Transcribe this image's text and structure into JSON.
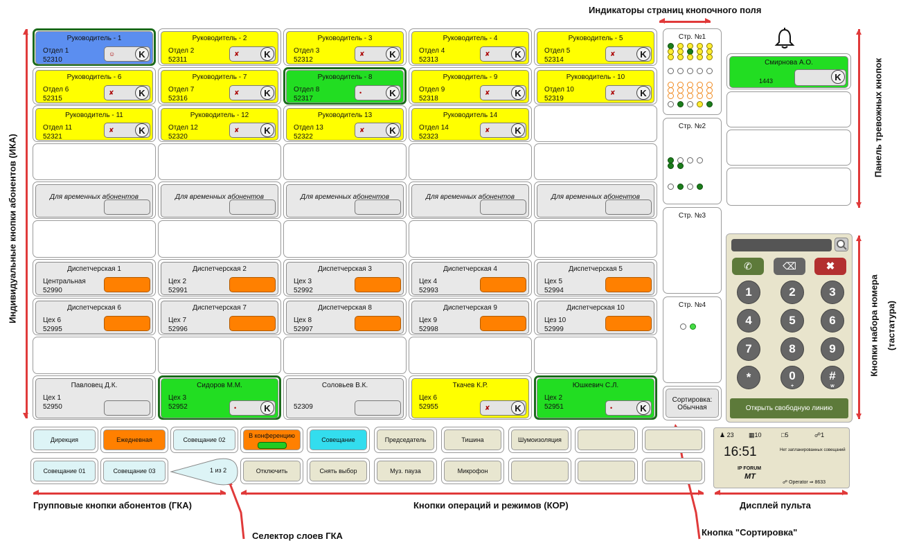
{
  "annotations": {
    "page_indicators": "Индикаторы страниц кнопочного поля",
    "ika": "Индивидуальные кнопки абонентов (ИКА)",
    "alarm_panel": "Панель тревожных кнопок",
    "dial_keys": "Кнопки набора номера",
    "dial_keys_sub": "(тастатура)",
    "gka": "Групповые кнопки абонентов (ГКА)",
    "kor": "Кнопки операций и режимов (КОР)",
    "display": "Дисплей пульта",
    "gka_selector": "Селектор слоев ГКА",
    "sort_button_label": "Кнопка \"Сортировка\""
  },
  "grid": {
    "k": "K",
    "temp": "Для временных абонентов",
    "r1": [
      {
        "t": "Руководитель - 1",
        "l1": "Отдел 1",
        "l2": "52310"
      },
      {
        "t": "Руководитель - 2",
        "l1": "Отдел 2",
        "l2": "52311"
      },
      {
        "t": "Руководитель - 3",
        "l1": "Отдел 3",
        "l2": "52312"
      },
      {
        "t": "Руководитель - 4",
        "l1": "Отдел 4",
        "l2": "52313"
      },
      {
        "t": "Руководитель - 5",
        "l1": "Отдел 5",
        "l2": "52314"
      }
    ],
    "r2": [
      {
        "t": "Руководитель - 6",
        "l1": "Отдел 6",
        "l2": "52315"
      },
      {
        "t": "Руководитель - 7",
        "l1": "Отдел 7",
        "l2": "52316"
      },
      {
        "t": "Руководитель - 8",
        "l1": "Отдел 8",
        "l2": "52317"
      },
      {
        "t": "Руководитель - 9",
        "l1": "Отдел 9",
        "l2": "52318"
      },
      {
        "t": "Руководитель - 10",
        "l1": "Отдел 10",
        "l2": "52319"
      }
    ],
    "r3": [
      {
        "t": "Руководитель - 11",
        "l1": "Отдел 11",
        "l2": "52321"
      },
      {
        "t": "Руководитель - 12",
        "l1": "Отдел 12",
        "l2": "52320"
      },
      {
        "t": "Руководитель 13",
        "l1": "Отдел 13",
        "l2": "52322"
      },
      {
        "t": "Руководитель 14",
        "l1": "Отдел 14",
        "l2": "52323"
      }
    ],
    "r7": [
      {
        "t": "Диспетчерская 1",
        "l1": "Центральная",
        "l2": "52990"
      },
      {
        "t": "Диспетчерская 2",
        "l1": "Цех 2",
        "l2": "52991"
      },
      {
        "t": "Диспетчерская 3",
        "l1": "Цех 3",
        "l2": "52992"
      },
      {
        "t": "Диспетчерская 4",
        "l1": "Цех 4",
        "l2": "52993"
      },
      {
        "t": "Диспетчерская 5",
        "l1": "Цех 5",
        "l2": "52994"
      }
    ],
    "r8": [
      {
        "t": "Диспетчерская 6",
        "l1": "Цех 6",
        "l2": "52995"
      },
      {
        "t": "Диспетчерская 7",
        "l1": "Цех 7",
        "l2": "52996"
      },
      {
        "t": "Диспетчерская 8",
        "l1": "Цех 8",
        "l2": "52997"
      },
      {
        "t": "Диспетчерская 9",
        "l1": "Цех 9",
        "l2": "52998"
      },
      {
        "t": "Диспетчерская 10",
        "l1": "Цез 10",
        "l2": "52999"
      }
    ],
    "r10": [
      {
        "t": "Павловец Д.К.",
        "l1": "Цех 1",
        "l2": "52950"
      },
      {
        "t": "Сидоров М.М.",
        "l1": "Цех 3",
        "l2": "52952"
      },
      {
        "t": "Соловьев В.К.",
        "l1": "",
        "l2": "52309"
      },
      {
        "t": "Ткачев К.Р.",
        "l1": "Цех 6",
        "l2": "52955"
      },
      {
        "t": "Юшкевич С.Л.",
        "l1": "Цех 2",
        "l2": "52951"
      }
    ]
  },
  "pages": {
    "p1": "Стр. №1",
    "p2": "Стр. №2",
    "p3": "Стр. №3",
    "p4": "Стр. №4",
    "sort1": "Сортировка:",
    "sort2": "Обычная"
  },
  "alarm": {
    "name": "Смирнова А.О.",
    "number": "1443",
    "k": "K"
  },
  "dialpad": {
    "keys": [
      "1",
      "2",
      "3",
      "4",
      "5",
      "6",
      "7",
      "8",
      "9",
      "*",
      "0",
      "#"
    ],
    "subs": {
      "0": "+",
      "#": "w"
    },
    "open_line": "Открыть свободную линию"
  },
  "gka": {
    "r1": [
      "Дирекция",
      "Ежедневная",
      "Совещание 02"
    ],
    "r2": [
      "Совещание 01",
      "Совещание 03"
    ],
    "selector": "1 из 2"
  },
  "kor": {
    "r1": [
      "В конференцию",
      "Совещание",
      "Председатель",
      "Тишина",
      "Шумоизоляция",
      "",
      ""
    ],
    "r2": [
      "Отключить",
      "Снять выбор",
      "Муз. пауза",
      "Микрофон",
      "",
      "",
      ""
    ]
  },
  "display": {
    "stat1": "23",
    "stat2": "10",
    "stat3": "5",
    "stat4": "1",
    "time": "16:51",
    "msg": "Нет запланированных совещаний",
    "logo1": "IP FORUM",
    "logo2": "MT",
    "operator": "Operator",
    "ext": "8633"
  },
  "colors": {
    "yellow": "#ffff00",
    "blue": "#5b8ef0",
    "green": "#22dd22",
    "dark_green_border": "#1b6b1b",
    "orange": "#ff8000",
    "arrow_red": "#e03a3a",
    "panel_beige": "#e8e4cc",
    "button_olive": "#5d7a3a"
  }
}
